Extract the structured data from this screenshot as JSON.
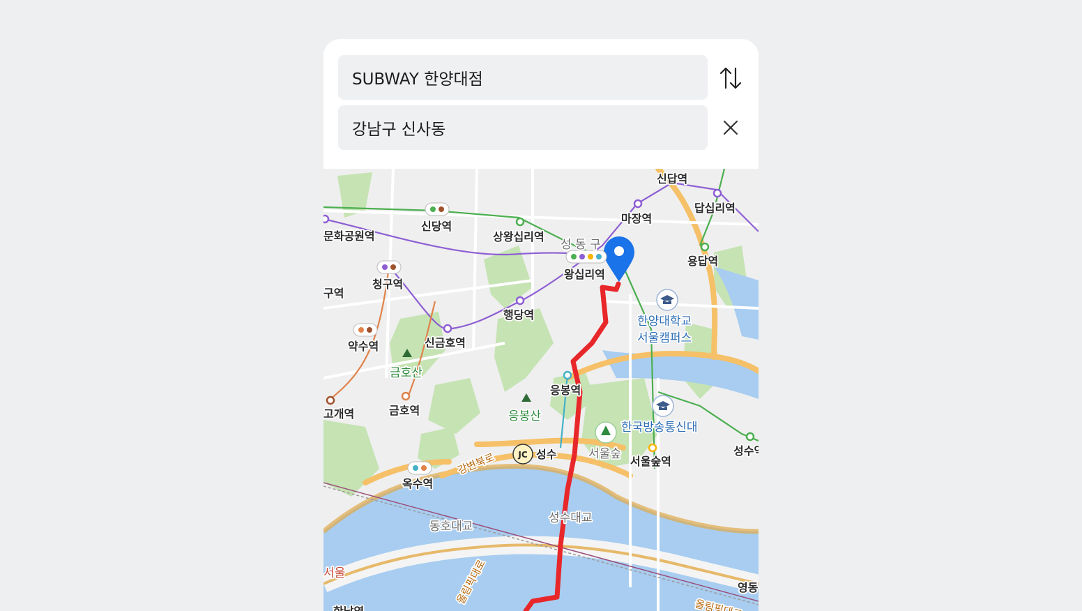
{
  "search": {
    "origin_value": "SUBWAY 한양대점",
    "destination_value": "강남구 신사동",
    "swap_icon": "swap-vertical-arrows-icon",
    "clear_icon": "close-icon"
  },
  "map": {
    "route_color": "#e8272a",
    "pin_color": "#1a73e8",
    "water_color": "#a8cdf0",
    "park_color": "#c6e3b4",
    "labels": {
      "sindap": "신답역",
      "dapsimni": "답십리역",
      "majang": "마장역",
      "yongdap": "용답역",
      "sindang": "신당역",
      "sangwangsimni": "상왕십리역",
      "district": "성 동 구",
      "wangsimni": "왕십리역",
      "munhwa_park": "문화공원역",
      "cheonggu": "청구역",
      "gu_station": "구역",
      "haengdang": "행당역",
      "hanyang_univ_1": "한양대학교",
      "hanyang_univ_2": "서울캠퍼스",
      "yaksu": "약수역",
      "singeumho": "신금호역",
      "geumhosan": "금호산",
      "eungbong": "응봉역",
      "goegae": "고개역",
      "geumho": "금호역",
      "eungbongsan": "응봉산",
      "knou": "한국방송통신대",
      "seongsu_station": "성수역",
      "gangbyeon": "강변북로",
      "jc_badge": "JC",
      "jc_name": "성수",
      "seoul_forest": "서울숲",
      "seoul_forest_station": "서울숲역",
      "oksu": "옥수역",
      "seongsu_bridge": "성수대교",
      "dongho_bridge": "동호대교",
      "seoul": "서울",
      "olympic_1": "올림픽대로",
      "olympic_2": "올림픽대로",
      "yeongdong": "영동",
      "hannam": "한남역"
    }
  }
}
